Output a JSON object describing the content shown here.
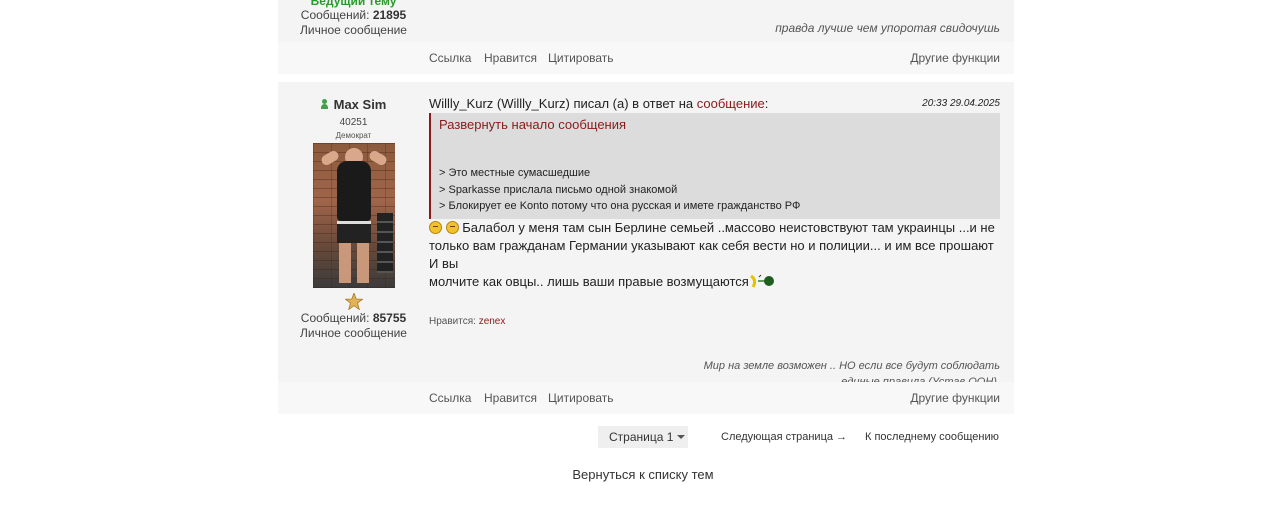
{
  "prev_post": {
    "user_role": "Ведущий тему",
    "messages_label": "Сообщений:",
    "messages_count": "21895",
    "pm_label": "Личное сообщение",
    "signature": "правда лучше чем упоротая свидочушь",
    "actions": {
      "link": "Ссылка",
      "like": "Нравится",
      "quote": "Цитировать",
      "more": "Другие функции"
    }
  },
  "post": {
    "author": "Max Sim",
    "online": true,
    "reputation": "40251",
    "user_title": "Демократ",
    "messages_label": "Сообщений:",
    "messages_count": "85755",
    "pm_label": "Личное сообщение",
    "header_text": "Willly_Kurz (Willly_Kurz) писал (а) в ответ на ",
    "header_link": "сообщение",
    "header_colon": ":",
    "date": "20:33 29.04.2025",
    "quote": {
      "expand": "Развернуть начало сообщения",
      "lines": [
        "> Это местные сумасшедшие",
        "> Sparkasse прислала письмо одной знакомой",
        "> Блокирует ее Konto потому что она русская и имете гражданство РФ"
      ]
    },
    "message_line1": "Балабол у меня там сын Берлине семьей ..массово неистовствуют там украинцы ...и не",
    "message_line2": "только вам гражданам Германии указывают как себя вести но и полиции... и им все прошают И вы",
    "message_line3": "молчите как овцы.. лишь ваши правые возмущаются",
    "likes_label": "Нравится:",
    "likes_user": "zenex",
    "signature_line1": "Мир на земле возможен .. НО если все будут соблюдать",
    "signature_line2": "единые правила (Устав ООН).",
    "actions": {
      "link": "Ссылка",
      "like": "Нравится",
      "quote": "Цитировать",
      "more": "Другие функции"
    }
  },
  "pagination": {
    "page_select": "Страница 1",
    "next": "Следующая страница →",
    "last": "К последнему сообщению"
  },
  "back_link": "Вернуться к списку тем",
  "colors": {
    "accent": "#8b1a1a",
    "online": "#43a047",
    "role": "#2a9a2a",
    "panel": "#f4f4f4"
  }
}
